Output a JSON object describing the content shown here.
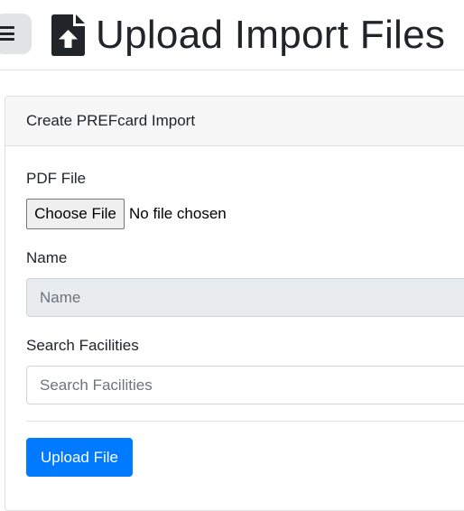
{
  "header": {
    "title": "Upload Import Files",
    "menu_icon": "hamburger-icon",
    "title_icon": "file-upload-icon"
  },
  "card": {
    "title": "Create PREFcard Import"
  },
  "form": {
    "pdf_label": "PDF File",
    "choose_file_label": "Choose File",
    "file_status": "No file chosen",
    "name_label": "Name",
    "name_placeholder": "Name",
    "name_value": "",
    "facilities_label": "Search Facilities",
    "facilities_placeholder": "Search Facilities",
    "facilities_value": "",
    "upload_label": "Upload File"
  },
  "colors": {
    "primary": "#007bff",
    "text": "#212529",
    "disabled_bg": "#e9ecef",
    "card_header_bg": "#f7f7f7"
  }
}
